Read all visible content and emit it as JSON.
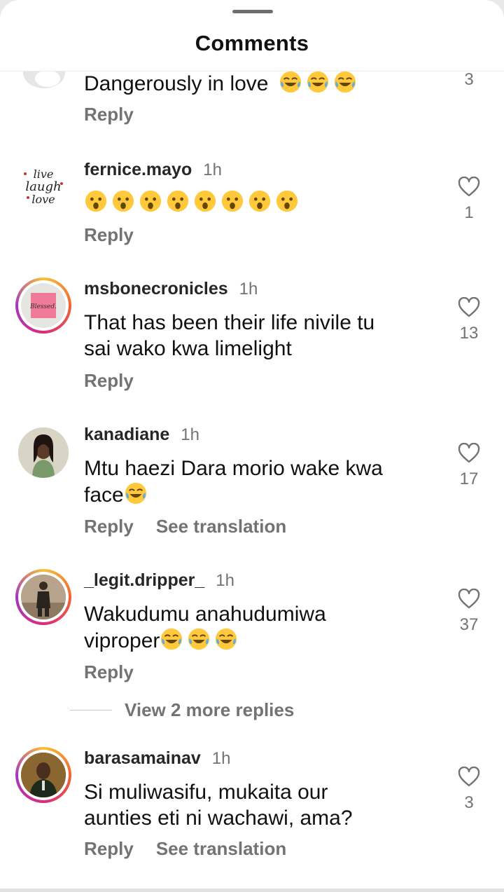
{
  "header": {
    "title": "Comments"
  },
  "comments": [
    {
      "username": "",
      "time": "",
      "text": "Dangerously in love",
      "emoji": [
        "joy",
        "joy",
        "joy"
      ],
      "likes": "3",
      "actions": [
        "Reply"
      ]
    },
    {
      "username": "fernice.mayo",
      "time": "1h",
      "text": "",
      "emoji": [
        "wow",
        "wow",
        "wow",
        "wow",
        "wow",
        "wow",
        "wow",
        "wow"
      ],
      "likes": "1",
      "actions": [
        "Reply"
      ],
      "avatar_text": [
        "live",
        "laugh",
        "love"
      ]
    },
    {
      "username": "msbonecronicles",
      "time": "1h",
      "text_lines": [
        "That has been their life nivile tu",
        "sai wako kwa limelight"
      ],
      "likes": "13",
      "actions": [
        "Reply"
      ],
      "avatar_text": "Blessed."
    },
    {
      "username": "kanadiane",
      "time": "1h",
      "text_lines": [
        "Mtu haezi Dara morio wake kwa",
        "face"
      ],
      "emoji_line2": [
        "joy"
      ],
      "likes": "17",
      "actions": [
        "Reply",
        "See translation"
      ]
    },
    {
      "username": "_legit.dripper_",
      "time": "1h",
      "text_lines": [
        "Wakudumu anahudumiwa",
        "viproper"
      ],
      "emoji_line2": [
        "joy",
        "joy",
        "joy"
      ],
      "likes": "37",
      "actions": [
        "Reply"
      ]
    },
    {
      "username": "barasamainav",
      "time": "1h",
      "text_lines": [
        "Si muliwasifu, mukaita our",
        "aunties eti ni wachawi, ama?"
      ],
      "likes": "3",
      "actions": [
        "Reply",
        "See translation"
      ]
    }
  ],
  "view_more": "View 2 more replies",
  "colors": {
    "text": "#111111",
    "secondary": "#737373",
    "username": "#262626"
  }
}
